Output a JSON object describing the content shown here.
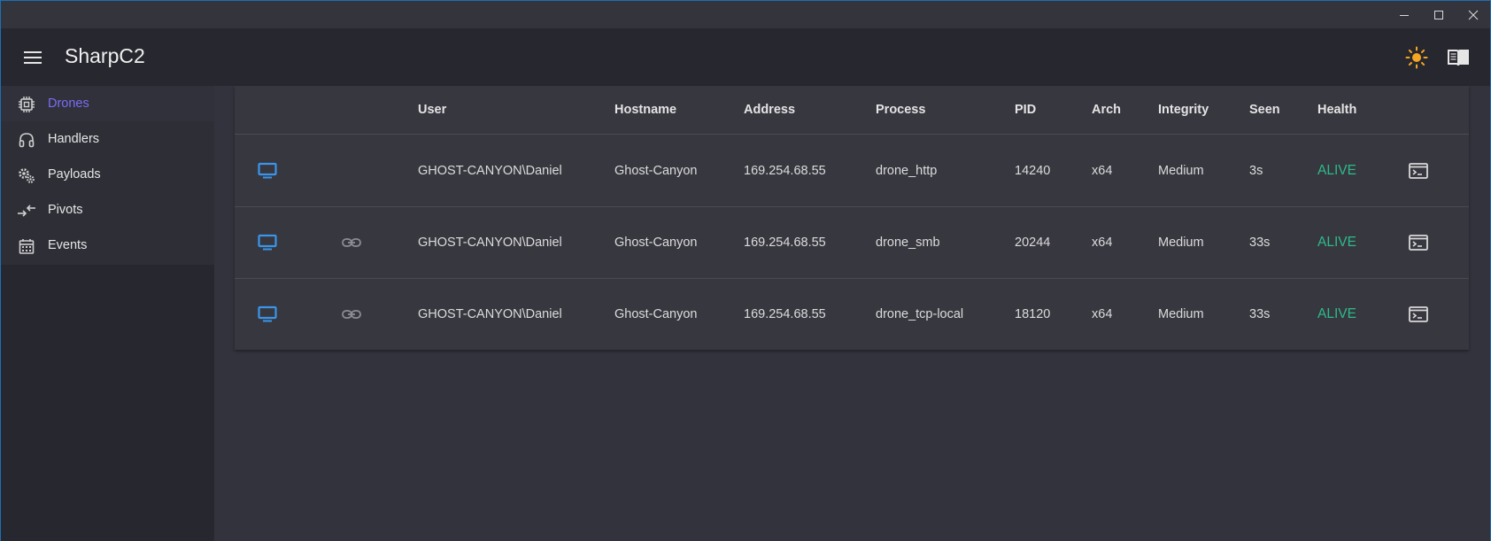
{
  "window": {
    "title": ""
  },
  "appbar": {
    "title": "SharpC2",
    "menu_icon": "menu-icon",
    "theme_icon": "sun-icon",
    "docs_icon": "book-icon"
  },
  "colors": {
    "accent": "#7b6cf6",
    "alive": "#2dbb8a",
    "drone_icon": "#3b95e8",
    "sun": "#f5a623"
  },
  "sidebar": {
    "items": [
      {
        "label": "Drones",
        "icon": "chip-icon",
        "active": true
      },
      {
        "label": "Handlers",
        "icon": "headset-icon",
        "active": false
      },
      {
        "label": "Payloads",
        "icon": "gears-icon",
        "active": false
      },
      {
        "label": "Pivots",
        "icon": "arrows-swap-icon",
        "active": false
      },
      {
        "label": "Events",
        "icon": "calendar-icon",
        "active": false
      }
    ]
  },
  "table": {
    "columns": [
      "User",
      "Hostname",
      "Address",
      "Process",
      "PID",
      "Arch",
      "Integrity",
      "Seen",
      "Health"
    ],
    "rows": [
      {
        "linked": false,
        "user": "GHOST-CANYON\\Daniel",
        "hostname": "Ghost-Canyon",
        "address": "169.254.68.55",
        "process": "drone_http",
        "pid": "14240",
        "arch": "x64",
        "integrity": "Medium",
        "seen": "3s",
        "health": "ALIVE"
      },
      {
        "linked": true,
        "user": "GHOST-CANYON\\Daniel",
        "hostname": "Ghost-Canyon",
        "address": "169.254.68.55",
        "process": "drone_smb",
        "pid": "20244",
        "arch": "x64",
        "integrity": "Medium",
        "seen": "33s",
        "health": "ALIVE"
      },
      {
        "linked": true,
        "user": "GHOST-CANYON\\Daniel",
        "hostname": "Ghost-Canyon",
        "address": "169.254.68.55",
        "process": "drone_tcp-local",
        "pid": "18120",
        "arch": "x64",
        "integrity": "Medium",
        "seen": "33s",
        "health": "ALIVE"
      }
    ]
  }
}
